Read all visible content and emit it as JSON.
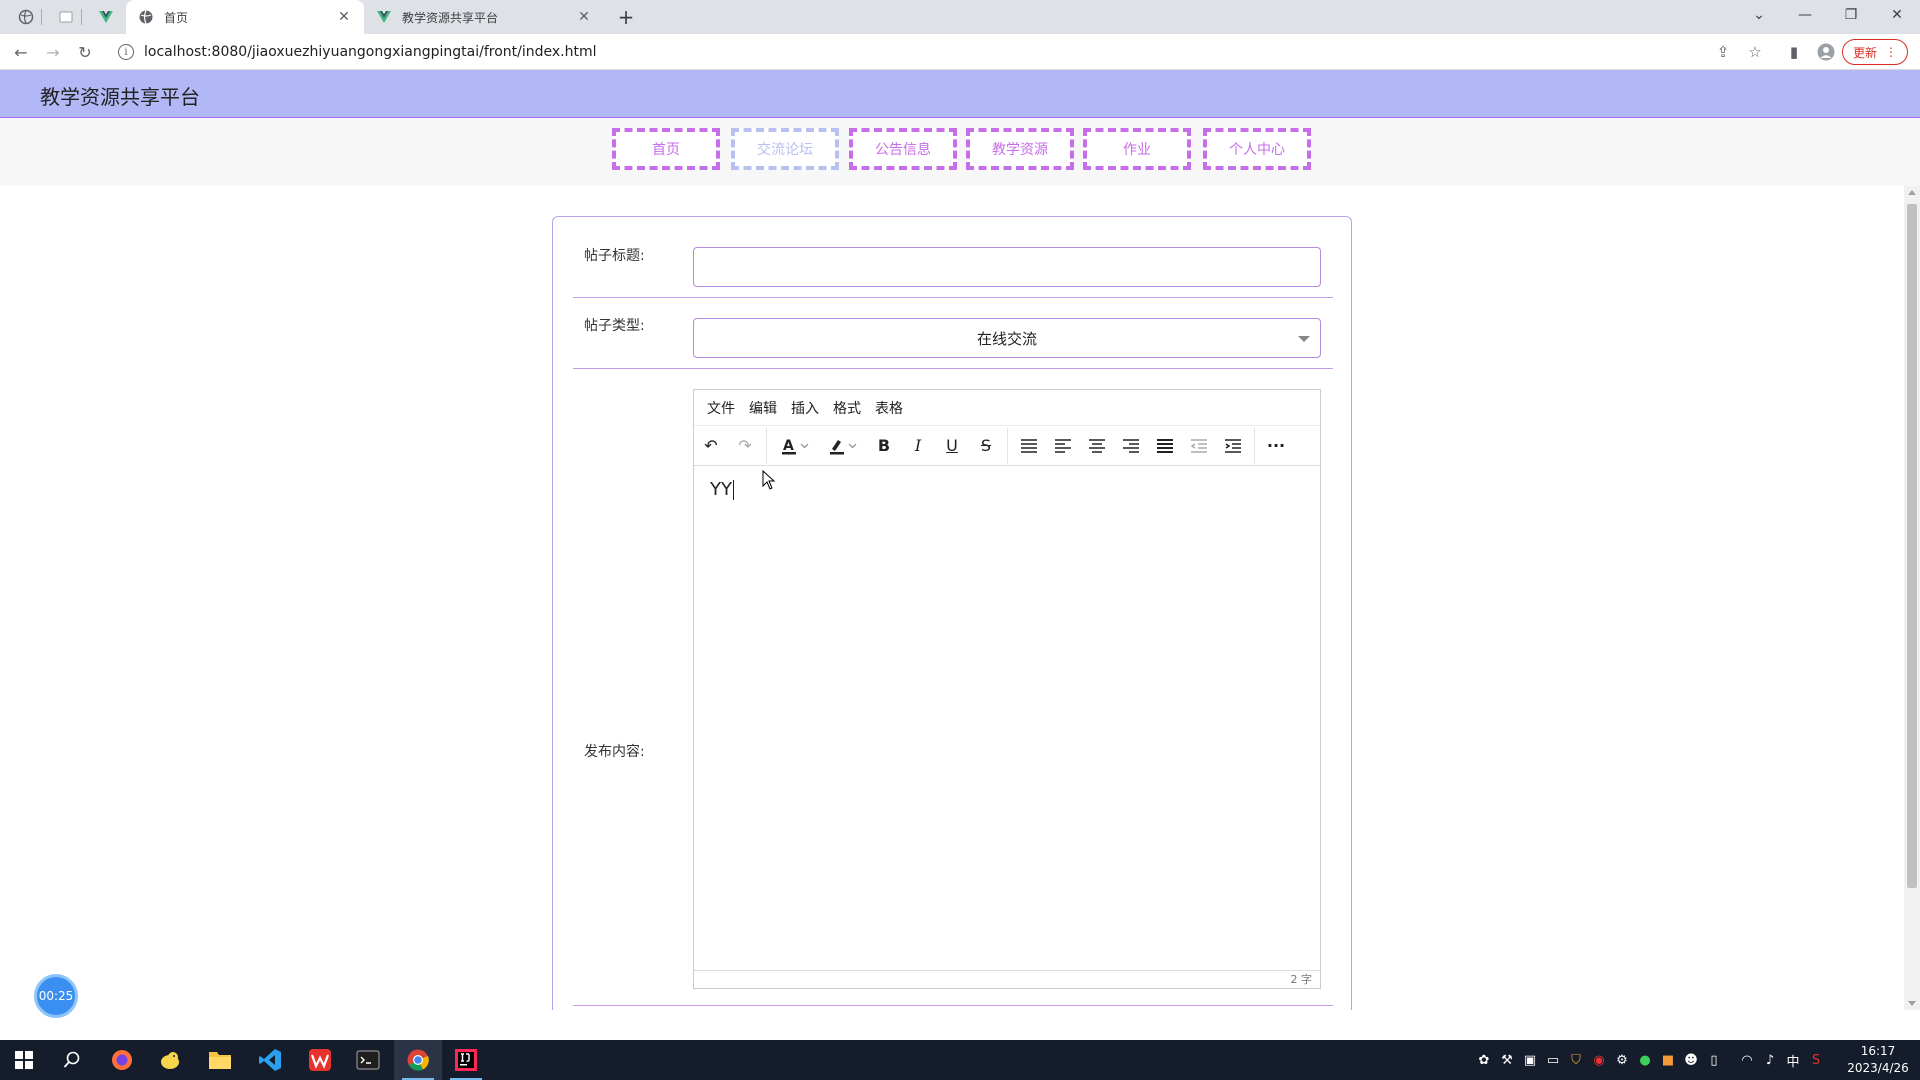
{
  "browser": {
    "tabs": [
      {
        "title": "首页",
        "active": true
      },
      {
        "title": "教学资源共享平台",
        "active": false
      }
    ],
    "url": "localhost:8080/jiaoxuezhiyuangongxiangpingtai/front/index.html",
    "update_label": "更新"
  },
  "site": {
    "title": "教学资源共享平台",
    "nav": [
      {
        "label": "首页"
      },
      {
        "label": "交流论坛"
      },
      {
        "label": "公告信息"
      },
      {
        "label": "教学资源"
      },
      {
        "label": "作业"
      },
      {
        "label": "个人中心"
      }
    ]
  },
  "form": {
    "title_label": "帖子标题:",
    "title_value": "",
    "type_label": "帖子类型:",
    "type_value": "在线交流",
    "content_label": "发布内容:",
    "editor": {
      "menu": [
        "文件",
        "编辑",
        "插入",
        "格式",
        "表格"
      ],
      "content": "YY",
      "word_count": "2 字"
    }
  },
  "timer": "00:25",
  "taskbar": {
    "time": "16:17",
    "date": "2023/4/26",
    "ime": "中"
  },
  "colors": {
    "header_bg": "#b1b8f5",
    "nav_border": "#c76ee9",
    "accent_line": "#c59be8"
  }
}
